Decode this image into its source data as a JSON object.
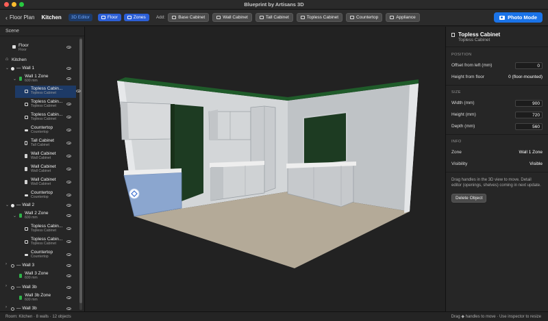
{
  "window": {
    "title": "Blueprint by Artisans 3D"
  },
  "toolbar": {
    "back_label": "Floor Plan",
    "room_name": "Kitchen",
    "mode_badge": "3D Editor",
    "toggles": [
      "Floor",
      "Zones"
    ],
    "add_label": "Add:",
    "add_buttons": [
      "Base Cabinet",
      "Wall Cabinet",
      "Tall Cabinet",
      "Topless Cabinet",
      "Countertop",
      "Appliance"
    ],
    "photo_mode": "Photo Mode"
  },
  "sidebar": {
    "header": "Scene",
    "rows": [
      {
        "main": "Floor",
        "sub": "Floor"
      },
      {
        "main": "Kitchen"
      },
      {
        "main": "Wall 1"
      },
      {
        "main": "Wall 1 Zone",
        "sub": "600 mm"
      },
      {
        "main": "Topless Cabin...",
        "sub": "Topless Cabinet"
      },
      {
        "main": "Topless Cabin...",
        "sub": "Topless Cabinet"
      },
      {
        "main": "Topless Cabin...",
        "sub": "Topless Cabinet"
      },
      {
        "main": "Countertop",
        "sub": "Countertop"
      },
      {
        "main": "Tall Cabinet",
        "sub": "Tall Cabinet"
      },
      {
        "main": "Wall Cabinet",
        "sub": "Wall Cabinet"
      },
      {
        "main": "Wall Cabinet",
        "sub": "Wall Cabinet"
      },
      {
        "main": "Wall Cabinet",
        "sub": "Wall Cabinet"
      },
      {
        "main": "Countertop",
        "sub": "Countertop"
      },
      {
        "main": "Wall 2"
      },
      {
        "main": "Wall 2 Zone",
        "sub": "600 mm"
      },
      {
        "main": "Topless Cabin...",
        "sub": "Topless Cabinet"
      },
      {
        "main": "Topless Cabin...",
        "sub": "Topless Cabinet"
      },
      {
        "main": "Countertop",
        "sub": "Countertop"
      },
      {
        "main": "Wall 3"
      },
      {
        "main": "Wall 3 Zone",
        "sub": "600 mm"
      },
      {
        "main": "Wall 3b"
      },
      {
        "main": "Wall 3b Zone",
        "sub": "600 mm"
      },
      {
        "main": "Wall 3b"
      }
    ]
  },
  "inspector": {
    "title": "Topless Cabinet",
    "subtitle": "Topless Cabinet",
    "position_label": "POSITION",
    "offset_label": "Offset from left (mm)",
    "offset_value": "0",
    "height_floor_label": "Height from floor",
    "height_floor_value": "0 (floor-mounted)",
    "size_label": "SIZE",
    "width_label": "Width (mm)",
    "width_value": "900",
    "height_label": "Height (mm)",
    "height_value": "720",
    "depth_label": "Depth (mm)",
    "depth_value": "560",
    "info_label": "INFO",
    "zone_label": "Zone",
    "zone_value": "Wall 1 Zone",
    "visibility_label": "Visibility",
    "visibility_value": "Visible",
    "note": "Drag handles in the 3D view to move. Detail editor (openings, shelves) coming in next update.",
    "delete_label": "Delete Object"
  },
  "status": {
    "left": "Room: Kitchen  ·  8 walls  ·  12 objects",
    "right": "Drag ◆ handles to move  ·  Use inspector to resize"
  },
  "colors": {
    "accent": "#1a73e8",
    "selected_cabinet": "#8ba6cf",
    "wall_top": "#1f5b2a",
    "dark_panel": "#1d3b22",
    "floor": "#b4aa98"
  }
}
